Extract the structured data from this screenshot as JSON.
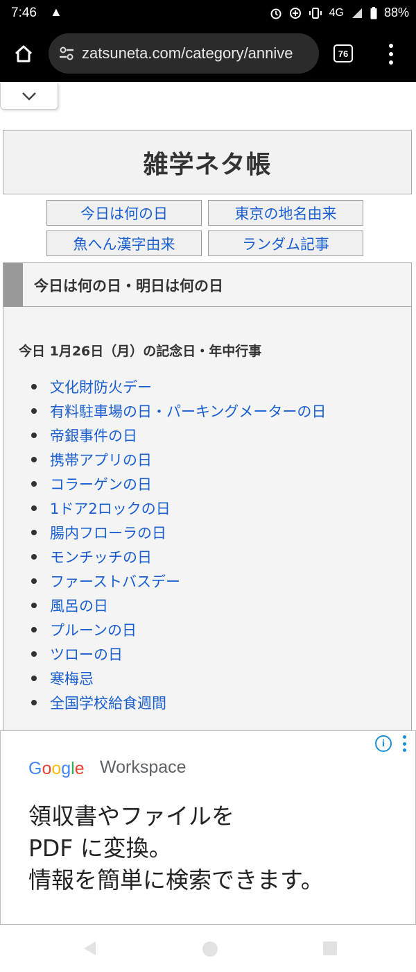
{
  "status_bar": {
    "time": "7:46",
    "network": "4G",
    "battery": "88%"
  },
  "browser": {
    "url": "zatsuneta.com/category/annive",
    "tab_count": "76"
  },
  "site": {
    "title": "雑学ネタ帳",
    "nav": [
      {
        "label": "今日は何の日"
      },
      {
        "label": "東京の地名由来"
      },
      {
        "label": "魚へん漢字由来"
      },
      {
        "label": "ランダム記事"
      }
    ]
  },
  "section": {
    "heading": "今日は何の日・明日は何の日",
    "date_heading": "今日 1月26日（月）の記念日・年中行事",
    "events": [
      {
        "label": "文化財防火デー"
      },
      {
        "label": "有料駐車場の日・パーキングメーターの日"
      },
      {
        "label": "帝銀事件の日"
      },
      {
        "label": "携帯アプリの日"
      },
      {
        "label": "コラーゲンの日"
      },
      {
        "label": "1ドア2ロックの日"
      },
      {
        "label": "腸内フローラの日"
      },
      {
        "label": "モンチッチの日"
      },
      {
        "label": "ファーストバスデー"
      },
      {
        "label": "風呂の日"
      },
      {
        "label": "プルーンの日"
      },
      {
        "label": "ツローの日"
      },
      {
        "label": "寒梅忌"
      },
      {
        "label": "全国学校給食週間"
      }
    ]
  },
  "ad": {
    "brand_product": "Workspace",
    "headline_lines": [
      "領収書やファイルを",
      "PDF に変換。",
      "情報を簡単に検索できます。"
    ],
    "colors": {
      "blue": "#4285F4",
      "red": "#EA4335",
      "yellow": "#FBBC05",
      "green": "#34A853"
    }
  },
  "colors": {
    "link": "#1a5fd0",
    "text": "#333333",
    "panel_bg": "#f4f4f4",
    "heading_bar": "#999999"
  }
}
